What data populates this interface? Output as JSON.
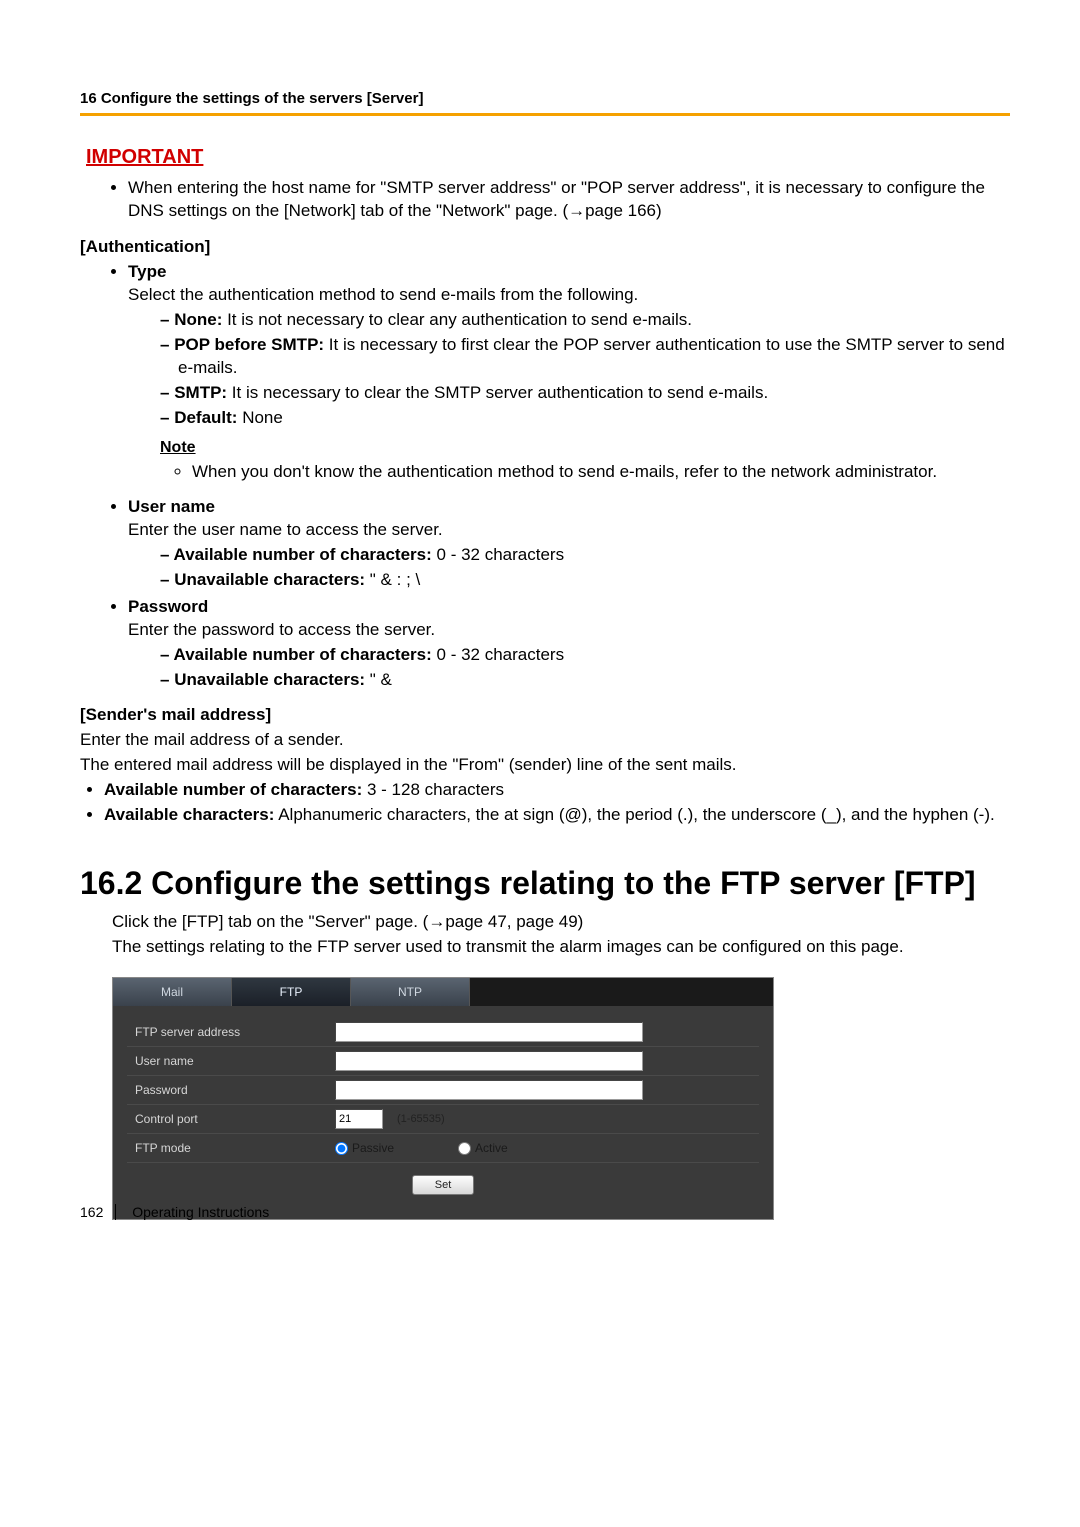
{
  "header": {
    "chapter_line": "16 Configure the settings of the servers [Server]"
  },
  "important": {
    "label": "IMPORTANT",
    "text_full": "When entering the host name for \"SMTP server address\" or \"POP server address\", it is necessary to configure the DNS settings on the [Network] tab of the \"Network\" page. (→page 166)"
  },
  "auth": {
    "heading": "[Authentication]",
    "type_label": "Type",
    "type_desc": "Select the authentication method to send e-mails from the following.",
    "none_label": "None:",
    "none_text": " It is not necessary to clear any authentication to send e-mails.",
    "pop_label": "POP before SMTP:",
    "pop_text": " It is necessary to first clear the POP server authentication to use the SMTP server to send e-mails.",
    "smtp_label": "SMTP:",
    "smtp_text": " It is necessary to clear the SMTP server authentication to send e-mails.",
    "default_label": "Default:",
    "default_text": " None",
    "note_label": "Note",
    "note_text": "When you don't know the authentication method to send e-mails, refer to the network administrator.",
    "user_label": "User name",
    "user_desc": "Enter the user name to access the server.",
    "user_avail_label": "Available number of characters:",
    "user_avail_text": " 0 - 32 characters",
    "user_unavail_label": "Unavailable characters:",
    "user_unavail_text": " \" & : ; \\",
    "pwd_label": "Password",
    "pwd_desc": "Enter the password to access the server.",
    "pwd_avail_label": "Available number of characters:",
    "pwd_avail_text": " 0 - 32 characters",
    "pwd_unavail_label": "Unavailable characters:",
    "pwd_unavail_text": " \" &"
  },
  "sender": {
    "heading": "[Sender's mail address]",
    "line1": "Enter the mail address of a sender.",
    "line2": "The entered mail address will be displayed in the \"From\" (sender) line of the sent mails.",
    "avail_label": "Available number of characters:",
    "avail_text": " 3 - 128 characters",
    "chars_label": "Available characters:",
    "chars_text": " Alphanumeric characters, the at sign (@), the period (.), the underscore (_), and the hyphen (-)."
  },
  "section": {
    "title": "16.2  Configure the settings relating to the FTP server [FTP]",
    "intro1": "Click the [FTP] tab on the \"Server\" page. (→page 47, page 49)",
    "intro2": "The settings relating to the FTP server used to transmit the alarm images can be configured on this page."
  },
  "screenshot": {
    "tabs": {
      "mail": "Mail",
      "ftp": "FTP",
      "ntp": "NTP"
    },
    "rows": {
      "server_addr": "FTP server address",
      "user": "User name",
      "password": "Password",
      "port": "Control port",
      "port_value": "21",
      "port_hint": "(1-65535)",
      "mode": "FTP mode",
      "mode_passive": "Passive",
      "mode_active": "Active"
    },
    "set_btn": "Set"
  },
  "footer": {
    "page": "162",
    "doc": "Operating Instructions"
  }
}
